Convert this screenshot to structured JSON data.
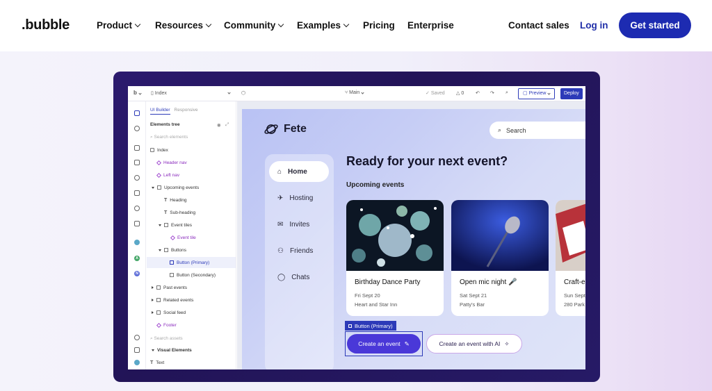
{
  "topnav": {
    "logo": ".bubble",
    "items": [
      "Product",
      "Resources",
      "Community",
      "Examples",
      "Pricing",
      "Enterprise"
    ],
    "contact": "Contact sales",
    "login": "Log in",
    "cta": "Get started"
  },
  "editor": {
    "page": "Index",
    "branch": "Main",
    "saved": "Saved",
    "issues": "0",
    "preview": "Preview",
    "deploy": "Deploy",
    "tabs": [
      "UI Builder",
      "Responsive"
    ],
    "panel_title": "Elements tree",
    "search_elements": "Search elements",
    "tree": {
      "index": "Index",
      "header_nav": "Header nav",
      "left_nav": "Left nav",
      "upcoming": "Upcoming events",
      "heading": "Heading",
      "subheading": "Sub-heading",
      "event_tiles": "Event tiles",
      "event_tile": "Event tile",
      "buttons": "Buttons",
      "btn_primary": "Button (Primary)",
      "btn_secondary": "Button (Secondary)",
      "past": "Past events",
      "related": "Related events",
      "social": "Social feed",
      "footer": "Footer"
    },
    "search_assets": "Search assets",
    "visual_elements": "Visual Elements",
    "text_item": "Text"
  },
  "app": {
    "logo": "Fete",
    "search": "Search",
    "nav": [
      "Home",
      "Hosting",
      "Invites",
      "Friends",
      "Chats"
    ],
    "headline": "Ready for your next event?",
    "subhead": "Upcoming events",
    "cards": [
      {
        "title": "Birthday Dance Party",
        "date": "Fri Sept 20",
        "venue": "Heart and Star Inn"
      },
      {
        "title": "Open mic night 🎤",
        "date": "Sat Sept 21",
        "venue": "Patty's Bar"
      },
      {
        "title": "Craft-e",
        "date": "Sun Sept",
        "venue": "280 Park"
      }
    ],
    "selected_tag": "Button (Primary)",
    "primary_btn": "Create an event",
    "secondary_btn": "Create an event with AI"
  },
  "colors": {
    "brand_blue": "#1d2bb1",
    "editor_accent": "#2c3ab8",
    "primary_button": "#4a38d8",
    "tree_purple": "#8a2bbd"
  }
}
